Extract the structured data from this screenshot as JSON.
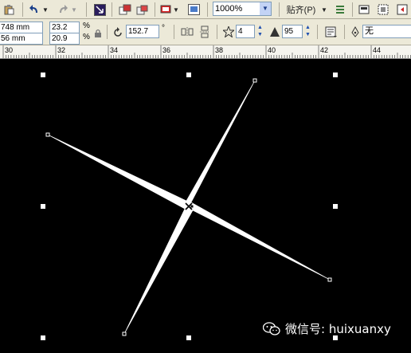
{
  "toolbar1": {
    "zoom_value": "1000%",
    "snap_label": "贴齐(P)"
  },
  "toolbar2": {
    "width_value": "748 mm",
    "height_value": "56 mm",
    "scale_x": "23.2",
    "scale_y": "20.9",
    "percent_x": "%",
    "percent_y": "%",
    "rotation_value": "152.7",
    "degree_symbol": "°",
    "star_points": "4",
    "star_sharpness": "95",
    "outline_value": "无"
  },
  "ruler": {
    "ticks": [
      "30",
      "32",
      "34",
      "36",
      "38",
      "40",
      "42",
      "44"
    ]
  },
  "watermark": {
    "text": "微信号: huixuanxy"
  },
  "colors": {
    "canvas": "#000000",
    "shape_fill": "#ffffff",
    "toolbar_bg": "#ece9d8"
  }
}
